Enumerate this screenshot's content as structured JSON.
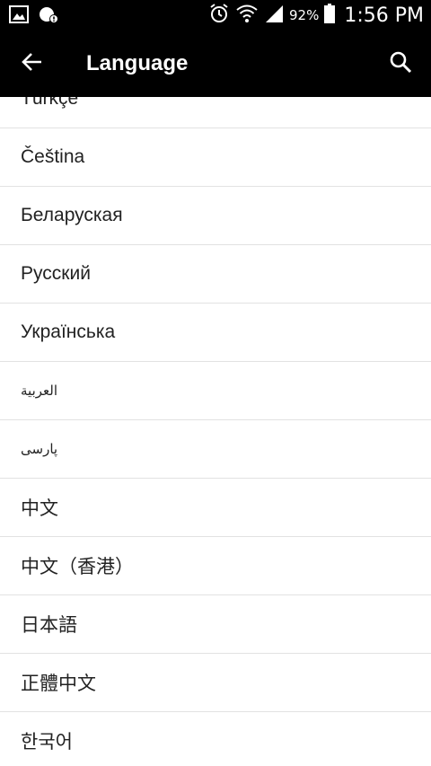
{
  "status_bar": {
    "battery_percent": "92%",
    "time": "1:56 PM",
    "icons": [
      "gallery-icon",
      "notification-icon",
      "alarm-icon",
      "wifi-icon",
      "signal-icon",
      "battery-icon"
    ]
  },
  "app_bar": {
    "title": "Language",
    "back_icon": "arrow-left-icon",
    "search_icon": "search-icon"
  },
  "languages": [
    "Türkçe",
    "Čeština",
    "Беларуская",
    "Русский",
    "Українська",
    "العربية",
    "پارسی",
    "中文",
    "中文（香港）",
    "日本語",
    "正體中文",
    "한국어"
  ],
  "colors": {
    "bar_background": "#000000",
    "list_background": "#ffffff",
    "divider": "#e2e2e2",
    "text": "#222222"
  }
}
